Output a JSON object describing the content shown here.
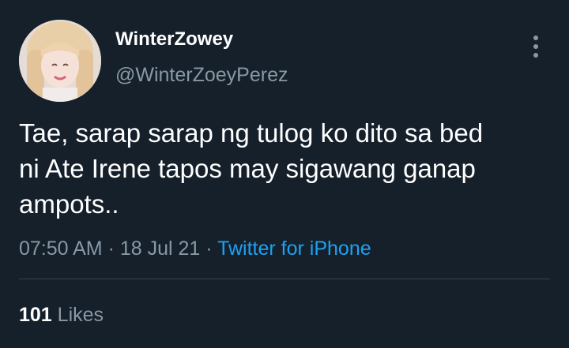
{
  "author": {
    "display_name": "WinterZowey",
    "handle": "@WinterZoeyPerez"
  },
  "tweet": {
    "text": "Tae, sarap sarap ng tulog ko dito sa bed\nni Ate Irene tapos may sigawang ganap\nampots..",
    "time": "07:50 AM",
    "separator": " · ",
    "date": "18 Jul 21",
    "source": "Twitter for iPhone"
  },
  "stats": {
    "likes_count": "101",
    "likes_label": "Likes"
  },
  "colors": {
    "background": "#15202b",
    "primary_text": "#ffffff",
    "secondary_text": "#8899a6",
    "link": "#1da1f2",
    "divider": "#38444d"
  },
  "icons": {
    "more": "more-vertical-icon"
  }
}
